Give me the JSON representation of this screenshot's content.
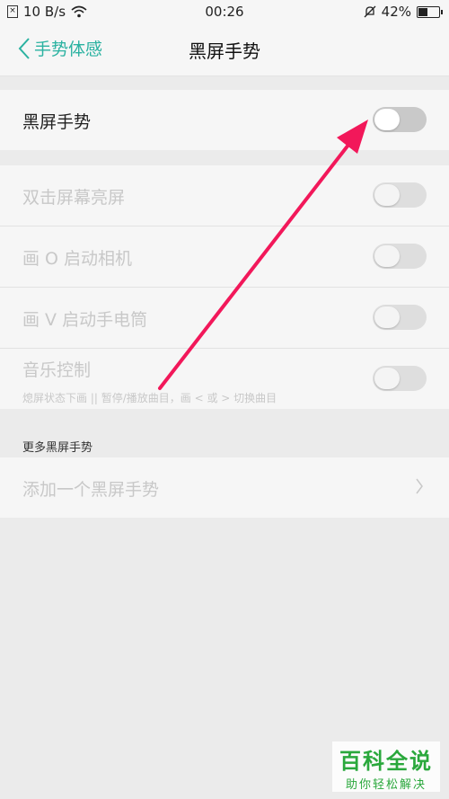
{
  "status_bar": {
    "net_speed": "10 B/s",
    "time": "00:26",
    "battery": "42%",
    "battery_level": 0.42
  },
  "nav": {
    "back_label": "手势体感",
    "title": "黑屏手势"
  },
  "main_toggle": {
    "label": "黑屏手势",
    "on": false
  },
  "gestures": [
    {
      "label": "双击屏幕亮屏",
      "on": false
    },
    {
      "label": "画 O 启动相机",
      "on": false
    },
    {
      "label": "画 V 启动手电筒",
      "on": false
    },
    {
      "label": "音乐控制",
      "sub": "熄屏状态下画 || 暂停/播放曲目，画 < 或 > 切换曲目",
      "on": false
    }
  ],
  "more": {
    "header": "更多黑屏手势",
    "add_label": "添加一个黑屏手势"
  },
  "watermark": {
    "title": "百科全说",
    "subtitle": "助你轻松解决"
  },
  "colors": {
    "accent": "#2bb2a1",
    "arrow": "#f2185a"
  }
}
